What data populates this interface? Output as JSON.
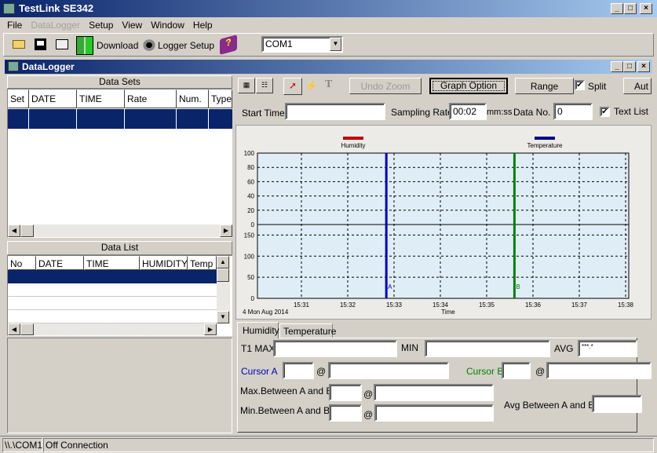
{
  "app": {
    "title": "TestLink SE342"
  },
  "menu": [
    "File",
    "DataLogger",
    "Setup",
    "View",
    "Window",
    "Help"
  ],
  "toolbar": {
    "download": "Download",
    "logger_setup": "Logger Setup",
    "port": "COM1"
  },
  "child": {
    "title": "DataLogger"
  },
  "datasets": {
    "title": "Data Sets",
    "columns": [
      "Set",
      "DATE",
      "TIME",
      "Rate",
      "Num.",
      "Type"
    ]
  },
  "datalist": {
    "title": "Data List",
    "columns": [
      "No",
      "DATE",
      "TIME",
      "HUMIDITY",
      "Temp"
    ]
  },
  "graph_toolbar": {
    "undo_zoom": "Undo Zoom",
    "graph_option": "Graph Option",
    "range": "Range",
    "split": "Split",
    "split_checked": true,
    "auto": "Aut"
  },
  "info": {
    "start_time_label": "Start Time",
    "start_time": "",
    "sampling_rate_label": "Sampling Rate",
    "sampling_rate": "00:02",
    "unit": "mm:ss",
    "data_no_label": "Data No.",
    "data_no": "0",
    "text_list": "Text List",
    "text_list_checked": true
  },
  "chart_data": {
    "type": "line",
    "legend": [
      {
        "name": "Humidity",
        "color": "#c00000"
      },
      {
        "name": "Temperature",
        "color": "#000080"
      }
    ],
    "xlabel": "Time",
    "date_label": "4 Mon Aug 2014",
    "x_ticks": [
      "15:31",
      "15:32",
      "15:33",
      "15:34",
      "15:35",
      "15:36",
      "15:37",
      "15:38"
    ],
    "upper_y_ticks": [
      100,
      80,
      60,
      40,
      20,
      0
    ],
    "lower_y_ticks": [
      150,
      100,
      50,
      0
    ],
    "grid": true,
    "cursors": [
      {
        "label": "A",
        "time": "15:32:50",
        "color": "#0000c0"
      },
      {
        "label": "B",
        "time": "15:35:36",
        "color": "#008000"
      }
    ],
    "series": []
  },
  "stats": {
    "tabs": [
      "Humidity",
      "Temperature"
    ],
    "t1max": "T1 MAX",
    "min": "MIN",
    "avg": "AVG",
    "avg_value": "***.*",
    "cursor_a": "Cursor A",
    "cursor_b": "Cursor B",
    "at": "@",
    "max_between": "Max.Between A and B",
    "min_between": "Min.Between A and B",
    "avg_between": "Avg Between A and B"
  },
  "status": {
    "port": "\\\\.\\COM1",
    "connection": "Off Connection"
  }
}
